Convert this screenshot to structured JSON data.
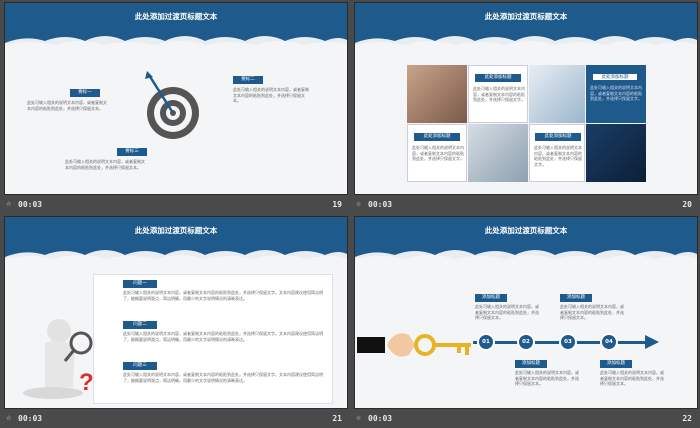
{
  "slides": [
    {
      "title": "此处添加过渡页标题文本",
      "time": "00:03",
      "number": "19",
      "labels": [
        "要标一",
        "要标二",
        "要标三"
      ],
      "texts": [
        "此处可输入相关的说明文本内容，或者复制文本内容的粘贴到此处，并选择只保留文本。",
        "此处可输入相关的说明文本内容，或者复制文本内容的粘贴到此处，并选择只保留文本。",
        "此处可输入相关的说明文本内容，或者复制文本内容的粘贴到此处，并选择只保留文本。"
      ]
    },
    {
      "title": "此处添加过渡页标题文本",
      "time": "00:03",
      "number": "20",
      "labels": [
        "此处添加标题",
        "此处添加标题",
        "此处添加标题",
        "此处添加标题"
      ],
      "texts": [
        "此处可输入相关的说明文本内容，或者复制文本内容的粘贴到此处，并选择只保留文字。",
        "此处可输入相关的说明文本内容，或者复制文本内容的粘贴到此处，并选择只保留文字。",
        "此处可输入相关的说明文本内容，或者复制文本内容的粘贴到此处，并选择只保留文字。",
        "此处可输入相关的说明文本内容，或者复制文本内容的粘贴到此处，并选择只保留文字。"
      ]
    },
    {
      "title": "此处添加过渡页标题文本",
      "time": "00:03",
      "number": "21",
      "labels": [
        "问题一",
        "问题二",
        "问题三"
      ],
      "texts": [
        "此处可输入相关的说明文本内容，或者复制文本内容的粘贴到此处，并选择只保留文字。文本内容建议使用简洁明了，能概要说明观点，简洁明确，用最少的文字说明情况的清晰表达。",
        "此处可输入相关的说明文本内容，或者复制文本内容的粘贴到此处，并选择只保留文字。文本内容建议使用简洁明了，能概要说明观点，简洁明确，用最少的文字说明情况的清晰表达。",
        "此处可输入相关的说明文本内容，或者复制文本内容的粘贴到此处，并选择只保留文字。文本内容建议使用简洁明了，能概要说明观点，简洁明确，用最少的文字说明情况的清晰表达。"
      ]
    },
    {
      "title": "此处添加过渡页标题文本",
      "time": "00:03",
      "number": "22",
      "steps": [
        "01",
        "02",
        "03",
        "04"
      ],
      "labels": [
        "添加标题",
        "添加标题",
        "添加标题",
        "添加标题"
      ],
      "texts": [
        "此处可输入相关的说明文本内容，或者复制文本内容的粘贴到此处，并选择只保留文本。",
        "此处可输入相关的说明文本内容，或者复制文本内容的粘贴到此处，并选择只保留文本。",
        "此处可输入相关的说明文本内容，或者复制文本内容的粘贴到此处，并选择只保留文本。",
        "此处可输入相关的说明文本内容，或者复制文本内容的粘贴到此处，并选择只保留文本。"
      ]
    }
  ],
  "colors": {
    "accent": "#1e5b8c",
    "background": "#4a4a4a",
    "slide": "#f4f5f7",
    "question_red": "#d9302c",
    "key_gold": "#e8b324"
  },
  "icons": {
    "footer": "star-icon",
    "target": "target-icon",
    "key": "key-icon",
    "magnifier": "magnifier-icon",
    "question": "question-mark-icon"
  }
}
